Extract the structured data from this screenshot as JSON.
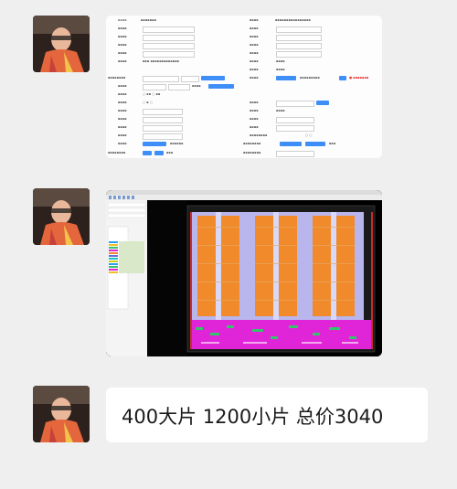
{
  "messages": [
    {
      "type": "image",
      "content": "form-screenshot"
    },
    {
      "type": "image",
      "content": "layout-screenshot"
    },
    {
      "type": "text",
      "text": "400大片 1200小片 总价3040"
    }
  ],
  "colors": {
    "background": "#efefef",
    "bubble": "#ffffff",
    "accent_button": "#3e8ef7",
    "cad_orange": "#f08a2a",
    "cad_magenta": "#e024d8",
    "cad_lavender": "#b9b6ee"
  }
}
